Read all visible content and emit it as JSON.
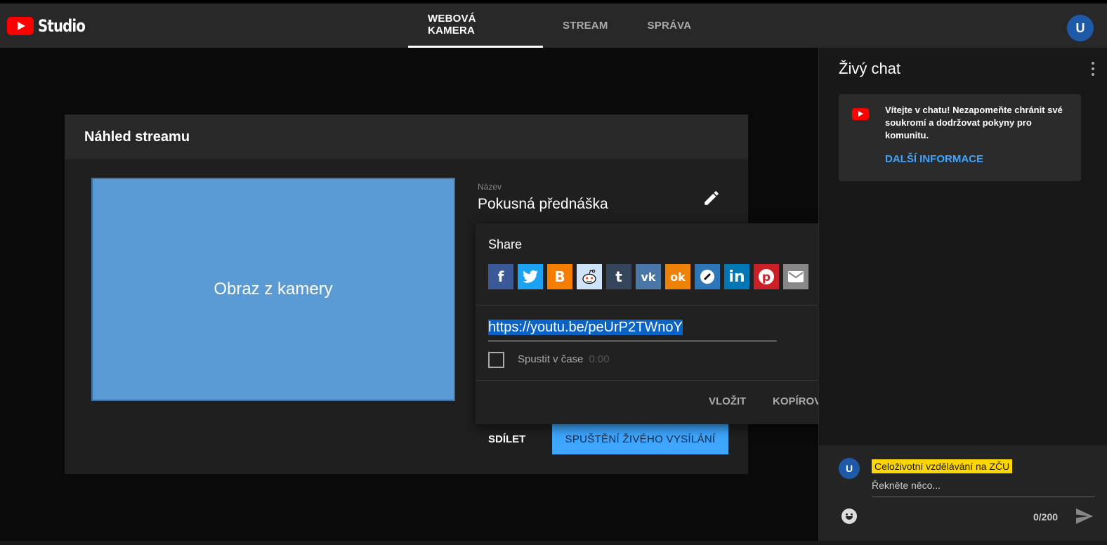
{
  "header": {
    "logo_text": "Studio",
    "tabs": [
      {
        "label": "WEBOVÁ KAMERA",
        "active": true
      },
      {
        "label": "STREAM",
        "active": false
      },
      {
        "label": "SPRÁVA",
        "active": false
      }
    ],
    "avatar_text": "U"
  },
  "preview": {
    "heading": "Náhled streamu",
    "camera_text": "Obraz z kamery",
    "title_label": "Název",
    "title_value": "Pokusná přednáška",
    "share_label": "SDÍLET",
    "live_button": "SPUŠTĚNÍ ŽIVÉHO VYSÍLÁNÍ"
  },
  "share": {
    "title": "Share",
    "icons": [
      {
        "name": "facebook",
        "glyph": "f",
        "color": "#3b5998"
      },
      {
        "name": "twitter",
        "glyph": "t",
        "color": "#1da1f2"
      },
      {
        "name": "blogger",
        "glyph": "B",
        "color": "#f57d00"
      },
      {
        "name": "reddit",
        "glyph": "r",
        "color": "#cee3f8"
      },
      {
        "name": "tumblr",
        "glyph": "t",
        "color": "#35465c"
      },
      {
        "name": "vk",
        "glyph": "vk",
        "color": "#4a76a8"
      },
      {
        "name": "odnoklassniki",
        "glyph": "ok",
        "color": "#ee8208"
      },
      {
        "name": "myspace",
        "glyph": "m",
        "color": "#2d77b8"
      },
      {
        "name": "linkedin",
        "glyph": "in",
        "color": "#0077b5"
      },
      {
        "name": "pinterest",
        "glyph": "p",
        "color": "#cb2027"
      },
      {
        "name": "email",
        "glyph": "✉",
        "color": "#888888"
      }
    ],
    "url": "https://youtu.be/peUrP2TWnoY",
    "start_at_label": "Spustit v čase",
    "start_at_time": "0:00",
    "embed_button": "VLOŽIT",
    "copy_button": "KOPÍROVAT"
  },
  "chat": {
    "title": "Živý chat",
    "welcome_text": "Vítejte v chatu! Nezapomeňte chránit své soukromí a dodržovat pokyny pro komunitu.",
    "welcome_link": "DALŠÍ INFORMACE",
    "channel_name": "Celoživotní vzdělávání na ZČU",
    "input_placeholder": "Řekněte něco...",
    "counter": "0/200",
    "avatar_text": "U"
  }
}
